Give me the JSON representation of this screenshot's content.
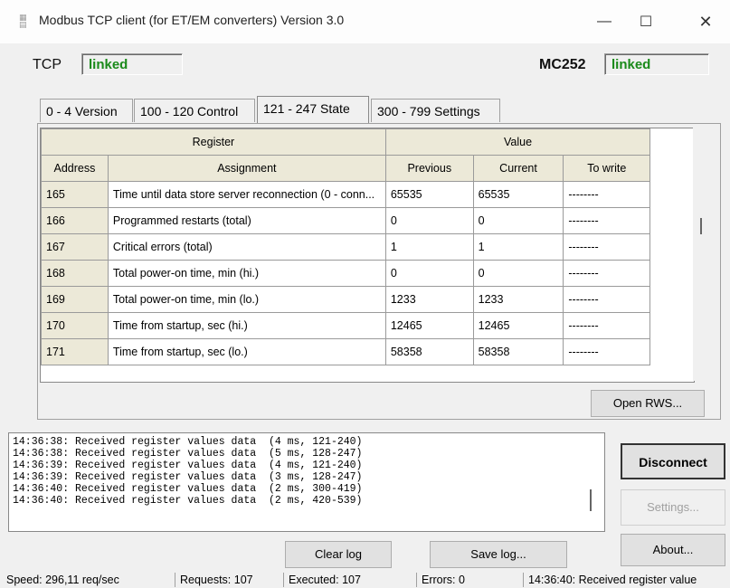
{
  "window": {
    "title": "Modbus TCP client (for ET/EM converters) Version 3.0",
    "minimize": "—",
    "maximize": "☐",
    "close": "✕",
    "icon": "modbus-app-icon"
  },
  "tcp": {
    "label": "TCP",
    "status": "linked"
  },
  "device": {
    "label": "MC252",
    "status": "linked"
  },
  "tabs": [
    {
      "label": "0 - 4  Version"
    },
    {
      "label": "100 - 120  Control"
    },
    {
      "label": "121 - 247  State"
    },
    {
      "label": "300 - 799  Settings"
    }
  ],
  "table": {
    "group_headers": {
      "register": "Register",
      "value": "Value"
    },
    "columns": [
      "Address",
      "Assignment",
      "Previous",
      "Current",
      "To write"
    ],
    "rows": [
      {
        "address": "165",
        "assignment": "Time until data store server reconnection (0 - conn...",
        "previous": "65535",
        "current": "65535",
        "to_write": "--------"
      },
      {
        "address": "166",
        "assignment": "Programmed restarts (total)",
        "previous": "0",
        "current": "0",
        "to_write": "--------"
      },
      {
        "address": "167",
        "assignment": "Critical errors (total)",
        "previous": "1",
        "current": "1",
        "to_write": "--------"
      },
      {
        "address": "168",
        "assignment": "Total power-on time, min (hi.)",
        "previous": "0",
        "current": "0",
        "to_write": "--------"
      },
      {
        "address": "169",
        "assignment": "Total power-on time, min (lo.)",
        "previous": "1233",
        "current": "1233",
        "to_write": "--------"
      },
      {
        "address": "170",
        "assignment": "Time from startup, sec (hi.)",
        "previous": "12465",
        "current": "12465",
        "to_write": "--------"
      },
      {
        "address": "171",
        "assignment": "Time from startup, sec (lo.)",
        "previous": "58358",
        "current": "58358",
        "to_write": "--------"
      }
    ]
  },
  "buttons": {
    "open_rws": "Open RWS...",
    "disconnect": "Disconnect",
    "settings": "Settings...",
    "about": "About...",
    "clear_log": "Clear log",
    "save_log": "Save log..."
  },
  "log": [
    "14:36:38: Received register values data  (4 ms, 121-240)",
    "14:36:38: Received register values data  (5 ms, 128-247)",
    "14:36:39: Received register values data  (4 ms, 121-240)",
    "14:36:39: Received register values data  (3 ms, 128-247)",
    "14:36:40: Received register values data  (2 ms, 300-419)",
    "14:36:40: Received register values data  (2 ms, 420-539)"
  ],
  "statusbar": {
    "speed": "Speed: 296,11 req/sec",
    "requests": "Requests: 107",
    "executed": "Executed: 107",
    "errors": "Errors: 0",
    "last": "14:36:40: Received register value"
  }
}
